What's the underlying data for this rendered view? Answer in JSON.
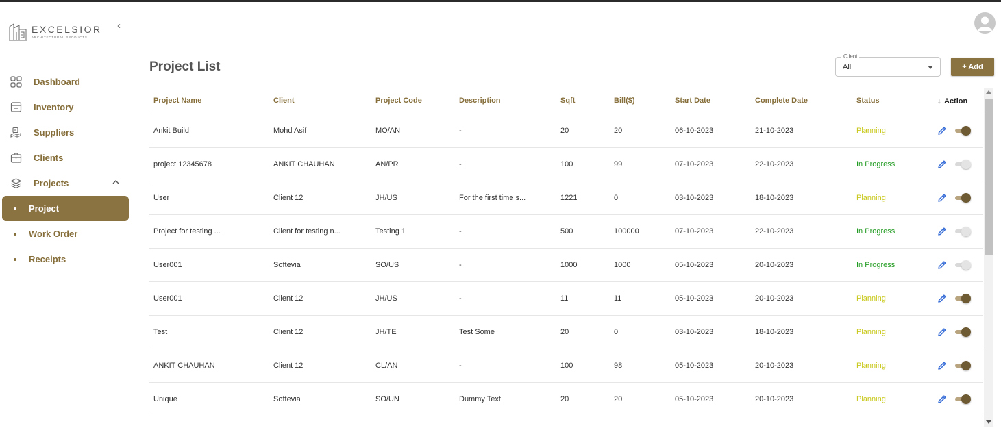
{
  "brand": {
    "name": "EXCELSIOR",
    "tagline": "ARCHITECTURAL PRODUCTS"
  },
  "sidebar": {
    "collapse_glyph": "‹",
    "items": [
      {
        "label": "Dashboard",
        "icon": "grid-icon"
      },
      {
        "label": "Inventory",
        "icon": "inventory-icon"
      },
      {
        "label": "Suppliers",
        "icon": "suppliers-icon"
      },
      {
        "label": "Clients",
        "icon": "clients-icon"
      },
      {
        "label": "Projects",
        "icon": "projects-icon"
      }
    ],
    "sub_items": [
      {
        "label": "Project",
        "active": true
      },
      {
        "label": "Work Order",
        "active": false
      },
      {
        "label": "Receipts",
        "active": false
      }
    ]
  },
  "header": {
    "title": "Project List",
    "client_filter": {
      "legend": "Client",
      "value": "All"
    },
    "add_label": "+ Add"
  },
  "table": {
    "columns": [
      "Project Name",
      "Client",
      "Project Code",
      "Description",
      "Sqft",
      "Bill($)",
      "Start Date",
      "Complete Date",
      "Status",
      "Action"
    ],
    "sort_glyph": "↓",
    "rows": [
      [
        "Ankit Build",
        "Mohd Asif",
        "MO/AN",
        "-",
        "20",
        "20",
        "06-10-2023",
        "21-10-2023",
        "Planning"
      ],
      [
        "project 12345678",
        "ANKIT CHAUHAN",
        "AN/PR",
        "-",
        "100",
        "99",
        "07-10-2023",
        "22-10-2023",
        "In Progress"
      ],
      [
        "User",
        "Client 12",
        "JH/US",
        "For the first time s...",
        "1221",
        "0",
        "03-10-2023",
        "18-10-2023",
        "Planning"
      ],
      [
        "Project for testing ...",
        "Client for testing n...",
        "Testing 1",
        "-",
        "500",
        "100000",
        "07-10-2023",
        "22-10-2023",
        "In Progress"
      ],
      [
        "User001",
        "Softevia",
        "SO/US",
        "-",
        "1000",
        "1000",
        "05-10-2023",
        "20-10-2023",
        "In Progress"
      ],
      [
        "User001",
        "Client 12",
        "JH/US",
        "-",
        "11",
        "11",
        "05-10-2023",
        "20-10-2023",
        "Planning"
      ],
      [
        "Test",
        "Client 12",
        "JH/TE",
        "Test Some",
        "20",
        "0",
        "03-10-2023",
        "18-10-2023",
        "Planning"
      ],
      [
        "ANKIT CHAUHAN",
        "Client 12",
        "CL/AN",
        "-",
        "100",
        "98",
        "05-10-2023",
        "20-10-2023",
        "Planning"
      ],
      [
        "Unique",
        "Softevia",
        "SO/UN",
        "Dummy Text",
        "20",
        "20",
        "05-10-2023",
        "20-10-2023",
        "Planning"
      ]
    ],
    "toggles": [
      true,
      false,
      true,
      false,
      false,
      true,
      true,
      true,
      true
    ]
  },
  "colors": {
    "brand": "#8a7241",
    "brand_text": "#866e3a",
    "planning": "#c8c81a",
    "in_progress": "#1f9a1f",
    "edit_icon": "#3a6fd8"
  }
}
